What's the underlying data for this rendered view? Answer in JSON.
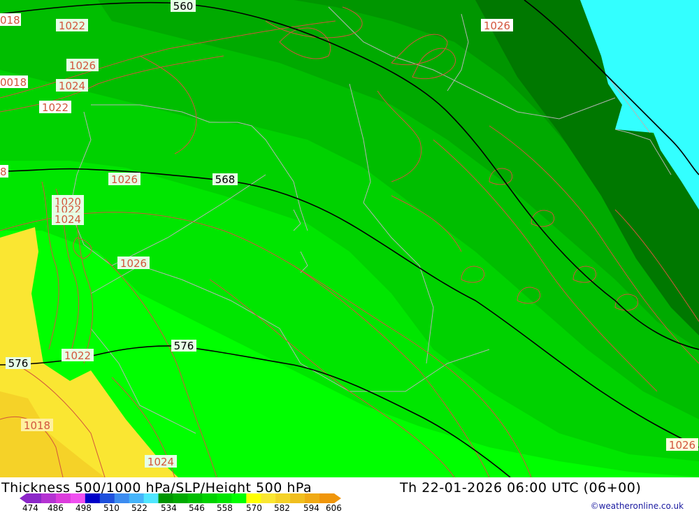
{
  "map": {
    "isobar_labels": [
      "1022",
      "1026",
      "1026",
      "1024",
      "1022",
      "1026",
      "1020",
      "1022",
      "1024",
      "1026",
      "1022",
      "1018",
      "1024",
      "1026",
      "018",
      "0018",
      "8"
    ],
    "height_labels": [
      "560",
      "568",
      "576",
      "576"
    ],
    "colors": {
      "sea": "#33ffff",
      "land_base": "#00e600",
      "isobar": "#d2553c",
      "height_line": "#000000",
      "border": "#b4b4b4"
    }
  },
  "footer": {
    "title": "Thickness 500/1000 hPa/SLP/Height 500 hPa",
    "datetime": "Th 22-01-2026 06:00 UTC (06+00)",
    "credit": "©weatheronline.co.uk",
    "scale_values": [
      "474",
      "486",
      "498",
      "510",
      "522",
      "534",
      "546",
      "558",
      "570",
      "582",
      "594",
      "606"
    ],
    "scale_colors": [
      "#8c28c8",
      "#b432d2",
      "#dc3cdc",
      "#f050f0",
      "#0000c8",
      "#1e50dc",
      "#3c8cf0",
      "#46b4fa",
      "#50e6ff",
      "#009600",
      "#00aa00",
      "#00be00",
      "#00d200",
      "#00e600",
      "#00ff00",
      "#ffff00",
      "#fae632",
      "#f5d228",
      "#f0be1e",
      "#f0aa14",
      "#f0960a"
    ]
  }
}
